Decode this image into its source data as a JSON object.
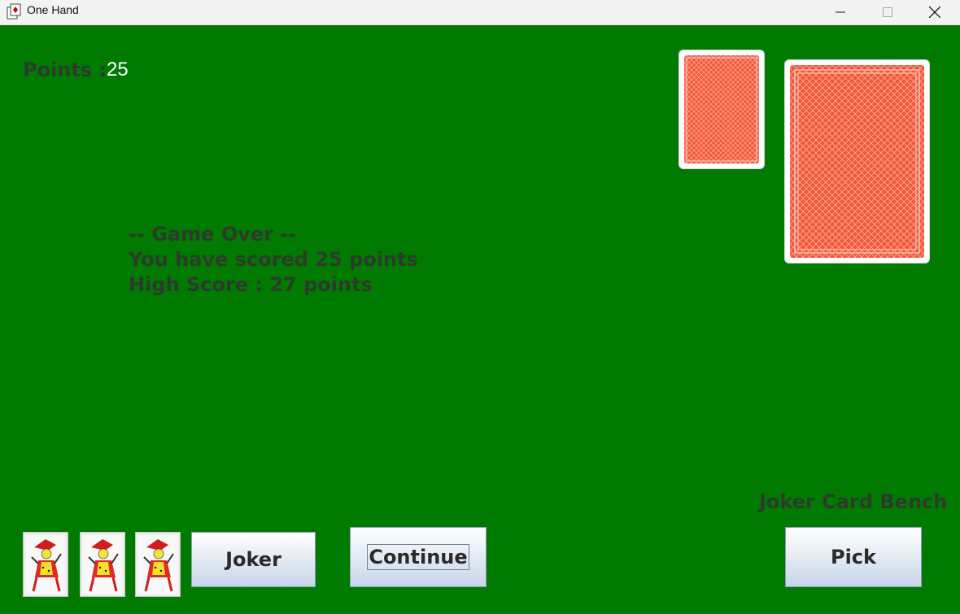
{
  "window": {
    "title": "One Hand",
    "controls": [
      "minimize-icon",
      "maximize-icon",
      "close-icon"
    ]
  },
  "score": {
    "label": "Points :",
    "value": "25"
  },
  "messages": {
    "line1": "-- Game Over --",
    "line2": "You have scored 25 points",
    "line3": "High Score : 27 points"
  },
  "bench": {
    "label": "Joker Card Bench"
  },
  "buttons": {
    "joker": "Joker",
    "continue": "Continue",
    "pick": "Pick"
  },
  "colors": {
    "felt": "#007a00",
    "card_back": "#f0583a",
    "text_dark": "#2d3b2d"
  }
}
